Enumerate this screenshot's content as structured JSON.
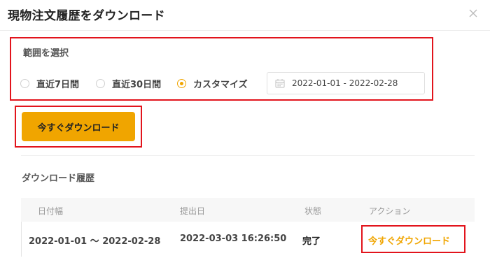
{
  "modal": {
    "title": "現物注文履歴をダウンロード"
  },
  "range": {
    "label": "範囲を選択",
    "options": [
      {
        "label": "直近7日間",
        "checked": false
      },
      {
        "label": "直近30日間",
        "checked": false
      },
      {
        "label": "カスタマイズ",
        "checked": true
      }
    ],
    "date_range": "2022-01-01  -  2022-02-28"
  },
  "download_button": {
    "label": "今すぐダウンロード"
  },
  "history": {
    "title": "ダウンロード履歴",
    "columns": [
      "日付幅",
      "提出日",
      "状態",
      "アクション"
    ],
    "rows": [
      {
        "date_range": "2022-01-01 ～ 2022-02-28",
        "submitted": "2022-03-03 16:26:50",
        "status": "完了",
        "action": "今すぐダウンロード"
      }
    ]
  },
  "colors": {
    "accent": "#f0a500",
    "highlight_border": "#e2141c"
  },
  "icons": {
    "close": "close-icon",
    "calendar": "calendar-icon"
  }
}
